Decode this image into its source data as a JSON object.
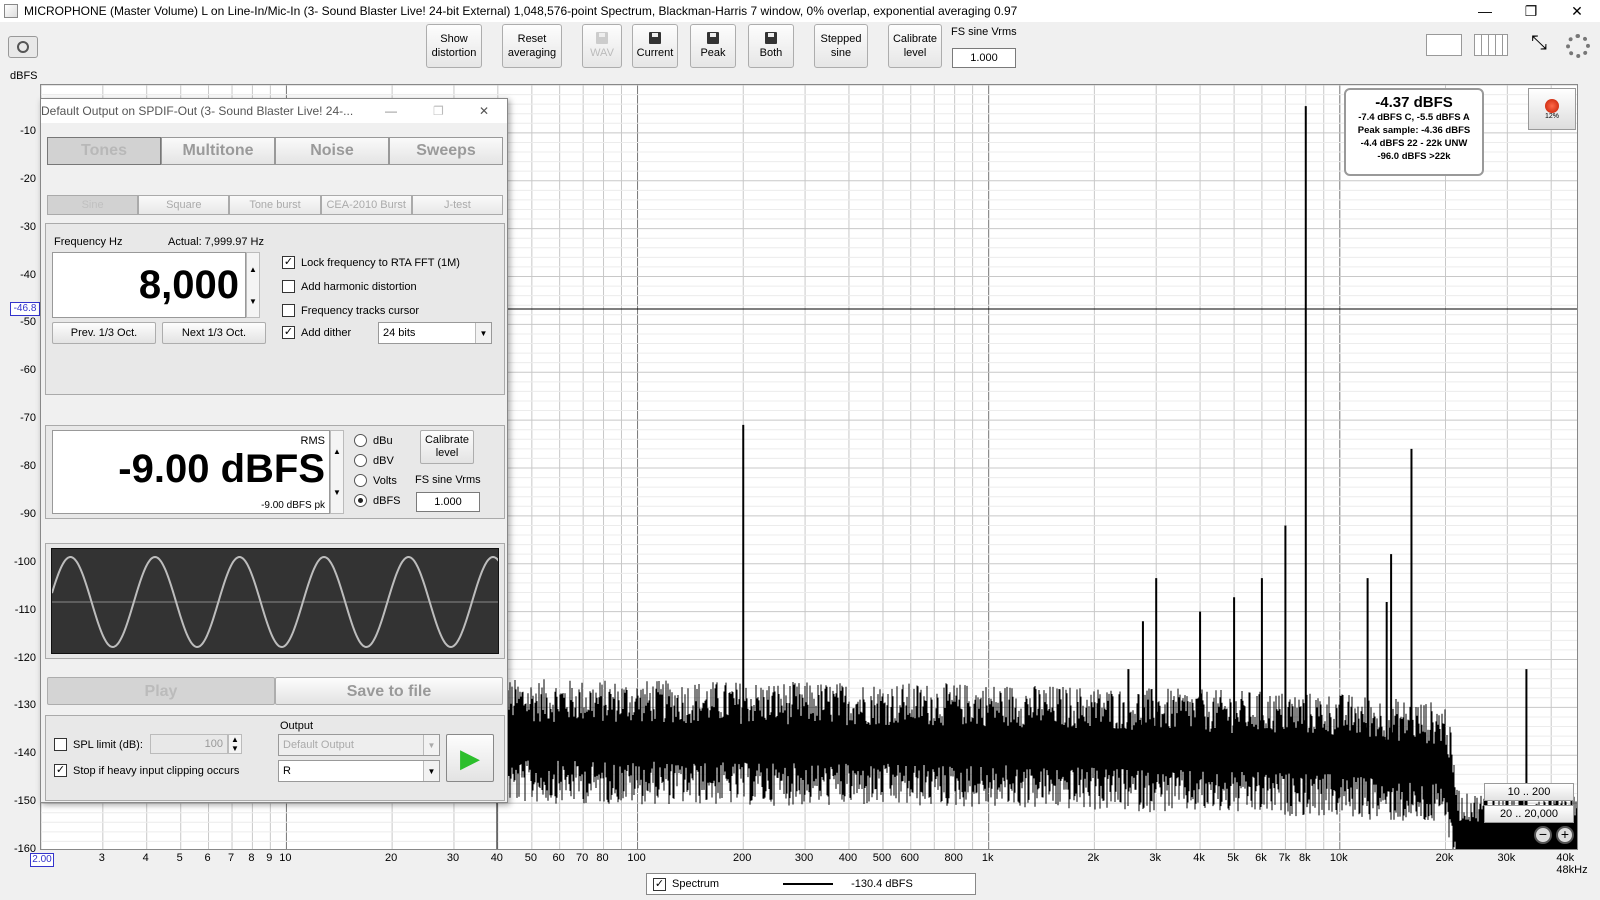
{
  "window": {
    "title": "MICROPHONE (Master Volume) L on Line-In/Mic-In (3- Sound Blaster Live! 24-bit External) 1,048,576-point Spectrum, Blackman-Harris 7 window, 0% overlap, exponential averaging 0.97",
    "minimize": "—",
    "restore": "❐",
    "close": "✕"
  },
  "toolbar": {
    "show_distortion": [
      "Show",
      "distortion"
    ],
    "reset_averaging": [
      "Reset",
      "averaging"
    ],
    "wav": "WAV",
    "current": "Current",
    "peak": "Peak",
    "both": "Both",
    "stepped_sine": [
      "Stepped",
      "sine"
    ],
    "calibrate_level": [
      "Calibrate",
      "level"
    ],
    "fs_label": "FS sine Vrms",
    "fs_value": "1.000"
  },
  "axis": {
    "y_unit": "dBFS",
    "y_ticks": [
      "-10",
      "-20",
      "-30",
      "-40",
      "-50",
      "-60",
      "-70",
      "-80",
      "-90",
      "-100",
      "-110",
      "-120",
      "-130",
      "-140",
      "-150",
      "-160"
    ],
    "cursor_value": "-46.8",
    "x_start": "2.00",
    "x_ticks": [
      "3",
      "4",
      "5",
      "6",
      "7",
      "8",
      "9",
      "10",
      "20",
      "30",
      "40",
      "50",
      "60",
      "70",
      "80",
      "100",
      "200",
      "300",
      "400",
      "500",
      "600",
      "800",
      "1k",
      "2k",
      "3k",
      "4k",
      "5k",
      "6k",
      "7k",
      "8k",
      "10k",
      "20k",
      "30k",
      "40k 48kHz"
    ]
  },
  "readout": {
    "main": "-4.37 dBFS",
    "line1": "-7.4 dBFS C, -5.5 dBFS A",
    "line2": "Peak sample: -4.36 dBFS",
    "line3": "-4.4 dBFS 22 - 22k UNW",
    "line4": "-96.0 dBFS >22k"
  },
  "rec_button": {
    "percent": "12%"
  },
  "ranges": {
    "r1": "10 .. 200",
    "r2": "20 .. 20,000"
  },
  "legend": {
    "name": "Spectrum",
    "value": "-130.4 dBFS"
  },
  "chart_data": {
    "type": "line",
    "title": "",
    "xlabel": "",
    "ylabel": "dBFS",
    "x_scale": "log",
    "xlim": [
      2,
      48000
    ],
    "ylim": [
      -160,
      0
    ],
    "grid": true,
    "series": [
      {
        "name": "Spectrum",
        "peaks": [
          {
            "x": 200,
            "y": -71
          },
          {
            "x": 1000,
            "y": -132
          },
          {
            "x": 2000,
            "y": -133
          },
          {
            "x": 2500,
            "y": -122
          },
          {
            "x": 2750,
            "y": -112
          },
          {
            "x": 3000,
            "y": -103
          },
          {
            "x": 4000,
            "y": -110
          },
          {
            "x": 5000,
            "y": -107
          },
          {
            "x": 6000,
            "y": -103
          },
          {
            "x": 7000,
            "y": -92
          },
          {
            "x": 8000,
            "y": -4.4
          },
          {
            "x": 12000,
            "y": -103
          },
          {
            "x": 13600,
            "y": -108
          },
          {
            "x": 14000,
            "y": -98
          },
          {
            "x": 16000,
            "y": -76
          },
          {
            "x": 34000,
            "y": -122
          }
        ],
        "noise_floor": [
          {
            "x": 40,
            "y": -137
          },
          {
            "x": 1000,
            "y": -138
          },
          {
            "x": 10000,
            "y": -140
          },
          {
            "x": 20000,
            "y": -142
          },
          {
            "x": 22000,
            "y": -158
          },
          {
            "x": 48000,
            "y": -157
          }
        ]
      }
    ]
  },
  "generator": {
    "title": "Default Output on SPDIF-Out (3- Sound Blaster Live! 24-...",
    "tabs": [
      "Tones",
      "Multitone",
      "Noise",
      "Sweeps"
    ],
    "subtabs": [
      "Sine",
      "Square",
      "Tone burst",
      "CEA-2010 Burst",
      "J-test"
    ],
    "freq_label": "Frequency Hz",
    "freq_actual": "Actual: 7,999.97 Hz",
    "freq_value": "8,000",
    "prev_oct": "Prev. 1/3 Oct.",
    "next_oct": "Next 1/3 Oct.",
    "lock_freq": "Lock frequency to RTA FFT (1M)",
    "add_harmonic": "Add harmonic distortion",
    "freq_tracks": "Frequency tracks cursor",
    "add_dither": "Add dither",
    "dither_bits": "24 bits",
    "rms_label": "RMS",
    "level_value": "-9.00 dBFS",
    "level_pk": "-9.00 dBFS pk",
    "units": [
      "dBu",
      "dBV",
      "Volts",
      "dBFS"
    ],
    "calibrate": [
      "Calibrate",
      "level"
    ],
    "fs_label": "FS sine Vrms",
    "fs_value": "1.000",
    "play": "Play",
    "save": "Save to file",
    "spl_limit": "SPL limit (dB):",
    "spl_value": "100",
    "stop_clip": "Stop if heavy input clipping occurs",
    "output_label": "Output",
    "output_device": "Default Output",
    "output_channel": "R",
    "check": "✓",
    "up": "▲",
    "down": "▼",
    "play_icon": "▶"
  }
}
